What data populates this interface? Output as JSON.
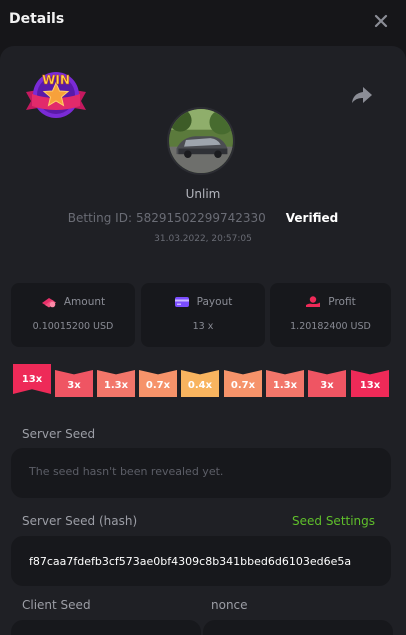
{
  "header": {
    "title": "Details"
  },
  "bet": {
    "username": "Unlim",
    "betting_id_label": "Betting ID:",
    "betting_id": "58291502299742330",
    "verified_label": "Verified",
    "timestamp": "31.03.2022, 20:57:05",
    "badge_text": "WIN"
  },
  "stats": {
    "amount_label": "Amount",
    "amount_value": "0.10015200 USD",
    "payout_label": "Payout",
    "payout_value": "13 x",
    "profit_label": "Profit",
    "profit_value": "1.20182400 USD"
  },
  "multipliers": [
    "13x",
    "3x",
    "1.3x",
    "0.7x",
    "0.4x",
    "0.7x",
    "1.3x",
    "3x",
    "13x"
  ],
  "multiplier_colors": [
    "#ee2a58",
    "#ef5563",
    "#f2766a",
    "#f6936a",
    "#f8b45f",
    "#f6936a",
    "#f2766a",
    "#ef5563",
    "#ee2a58"
  ],
  "active_multiplier_index": 0,
  "seeds": {
    "server_seed_label": "Server Seed",
    "server_seed_placeholder": "The seed hasn't been revealed yet.",
    "server_hash_label": "Server Seed (hash)",
    "seed_settings_label": "Seed Settings",
    "server_hash_value": "f87caa7fdefb3cf573ae0bf4309c8b341bbed6d6103ed6e5a",
    "client_seed_label": "Client Seed",
    "nonce_label": "nonce"
  },
  "colors": {
    "background": "#161619",
    "panel": "#1f2025",
    "card": "#17181c",
    "accent_green": "#5fbf2b",
    "accent_red": "#ee2a58",
    "payout_icon": "#7b4dff"
  },
  "icons": {
    "close": "close-icon",
    "share": "share-icon",
    "amount": "money-stack-icon",
    "payout": "credit-card-icon",
    "profit": "hand-coin-icon"
  }
}
